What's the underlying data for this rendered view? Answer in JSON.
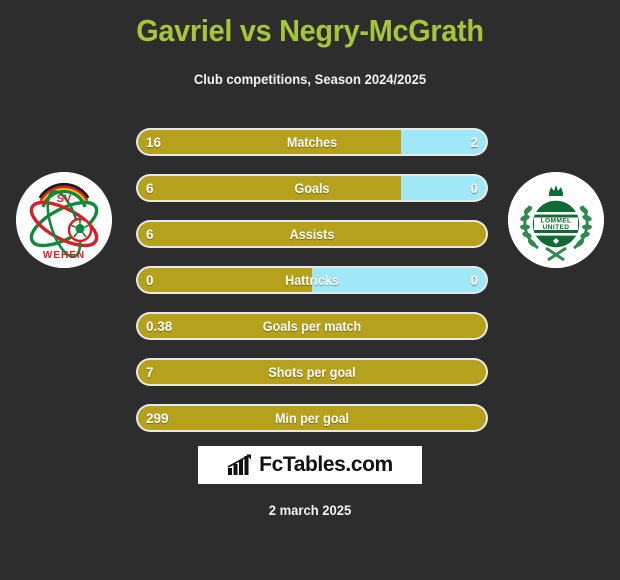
{
  "header": {
    "title": "Gavriel vs Negry-McGrath",
    "subtitle": "Club competitions, Season 2024/2025",
    "title_color": "#a4c639",
    "background_color": "#2d2d2d"
  },
  "teams": {
    "home": {
      "logo_name": "sv-wehen-wiesbaden-logo",
      "logo_text_top": "SV",
      "logo_text_bottom": "WEHEN"
    },
    "away": {
      "logo_name": "lommel-united-logo",
      "logo_text_top": "LOMMEL",
      "logo_text_bottom": "UNITED"
    }
  },
  "colors": {
    "home_fill": "#b5a11b",
    "away_fill": "#a0e7f8",
    "bar_border": "#e9e9e4"
  },
  "stats": [
    {
      "label": "Matches",
      "home": "16",
      "away": "2",
      "home_percent": 75.6,
      "show_away": true
    },
    {
      "label": "Goals",
      "home": "6",
      "away": "0",
      "home_percent": 75.6,
      "show_away": true
    },
    {
      "label": "Assists",
      "home": "6",
      "away": "",
      "home_percent": 100,
      "show_away": false
    },
    {
      "label": "Hattricks",
      "home": "0",
      "away": "0",
      "home_percent": 50,
      "show_away": true
    },
    {
      "label": "Goals per match",
      "home": "0.38",
      "away": "",
      "home_percent": 100,
      "show_away": false
    },
    {
      "label": "Shots per goal",
      "home": "7",
      "away": "",
      "home_percent": 100,
      "show_away": false
    },
    {
      "label": "Min per goal",
      "home": "299",
      "away": "",
      "home_percent": 100,
      "show_away": false
    }
  ],
  "footer": {
    "brand_name": "FcTables.com",
    "brand_icon": "bar-chart-icon",
    "date": "2 march 2025"
  }
}
